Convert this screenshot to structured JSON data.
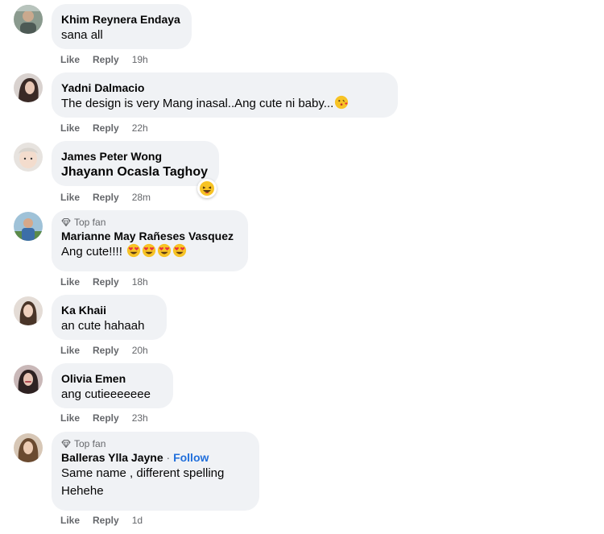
{
  "labels": {
    "like": "Like",
    "reply": "Reply",
    "top_fan": "Top fan",
    "follow": "Follow"
  },
  "comments": [
    {
      "author": "Khim Reynera Endaya",
      "text": "sana all",
      "time": "19h"
    },
    {
      "author": "Yadni Dalmacio",
      "text": "The design is very Mang inasal..Ang cute ni baby...",
      "time": "22h",
      "emoji": "kissing-heart-emoji"
    },
    {
      "author": "James Peter Wong",
      "text": "Jhayann Ocasla Taghoy",
      "time": "28m",
      "reaction": "laughing-reaction"
    },
    {
      "author": "Marianne May Rañeses Vasquez",
      "text": "Ang cute!!!!",
      "time": "18h",
      "badge": "Top fan",
      "emoji": "heart-eyes-emoji x4"
    },
    {
      "author": "Ka Khaii",
      "text": "an cute hahaah",
      "time": "20h"
    },
    {
      "author": "Olivia Emen",
      "text": "ang cutieeeeeee",
      "time": "23h"
    },
    {
      "author": "Balleras Ylla Jayne",
      "text_line1": "Same name , different spelling",
      "text_line2": "Hehehe",
      "time": "1d",
      "badge": "Top fan"
    }
  ],
  "colors": {
    "bubble": "#f0f2f5",
    "meta": "#65676b",
    "follow": "#216fdb"
  }
}
